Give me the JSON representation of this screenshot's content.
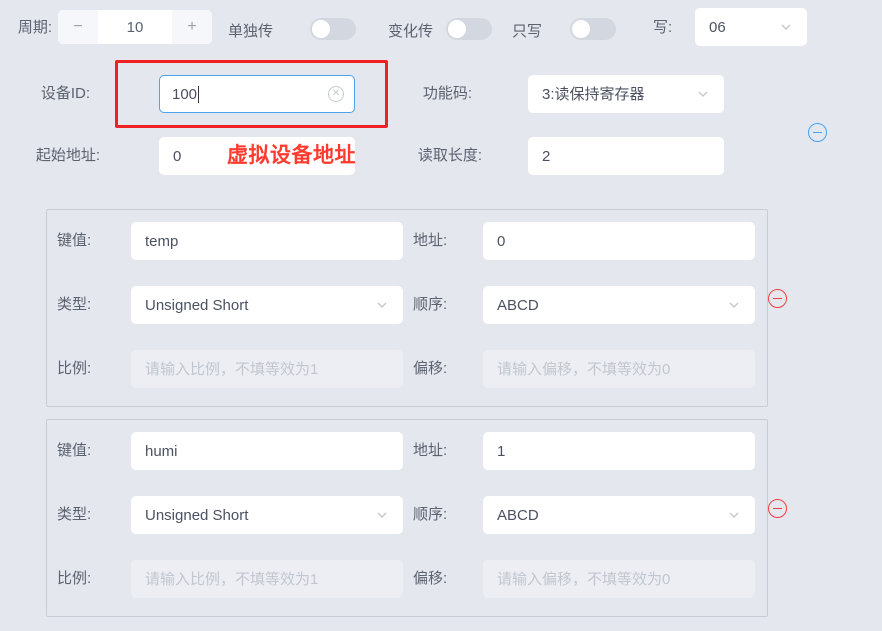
{
  "toolbar": {
    "period_label": "周期:",
    "period_decrement": "−",
    "period_value": "10",
    "period_increment": "+",
    "single_transmit_label": "单独传",
    "change_transmit_label": "变化传",
    "write_only_label": "只写",
    "write_label": "写:",
    "write_value": "06"
  },
  "device": {
    "device_id_label": "设备ID:",
    "device_id_value": "100",
    "clear_icon": "clear-circle-icon",
    "function_code_label": "功能码:",
    "function_code_value": "3:读保持寄存器",
    "start_address_label": "起始地址:",
    "start_address_value": "0",
    "annotation_text": "虚拟设备地址",
    "read_length_label": "读取长度:",
    "read_length_value": "2",
    "remove_icon": "circle-minus-icon"
  },
  "item_labels": {
    "key": "键值:",
    "address": "地址:",
    "type": "类型:",
    "order": "顺序:",
    "ratio": "比例:",
    "offset": "偏移:",
    "ratio_placeholder": "请输入比例，不填等效为1",
    "offset_placeholder": "请输入偏移，不填等效为0",
    "remove_icon": "circle-minus-icon"
  },
  "items": [
    {
      "key": "temp",
      "address": "0",
      "type": "Unsigned Short",
      "order": "ABCD",
      "ratio": "",
      "offset": ""
    },
    {
      "key": "humi",
      "address": "1",
      "type": "Unsigned Short",
      "order": "ABCD",
      "ratio": "",
      "offset": ""
    }
  ],
  "colors": {
    "background": "#e4e7ed",
    "annotation_red": "#ff3b30",
    "highlight_box_red": "#ef2121",
    "focus_blue": "#4aa3f0",
    "remove_blue": "#48a3f5",
    "remove_red": "#f23f42"
  }
}
